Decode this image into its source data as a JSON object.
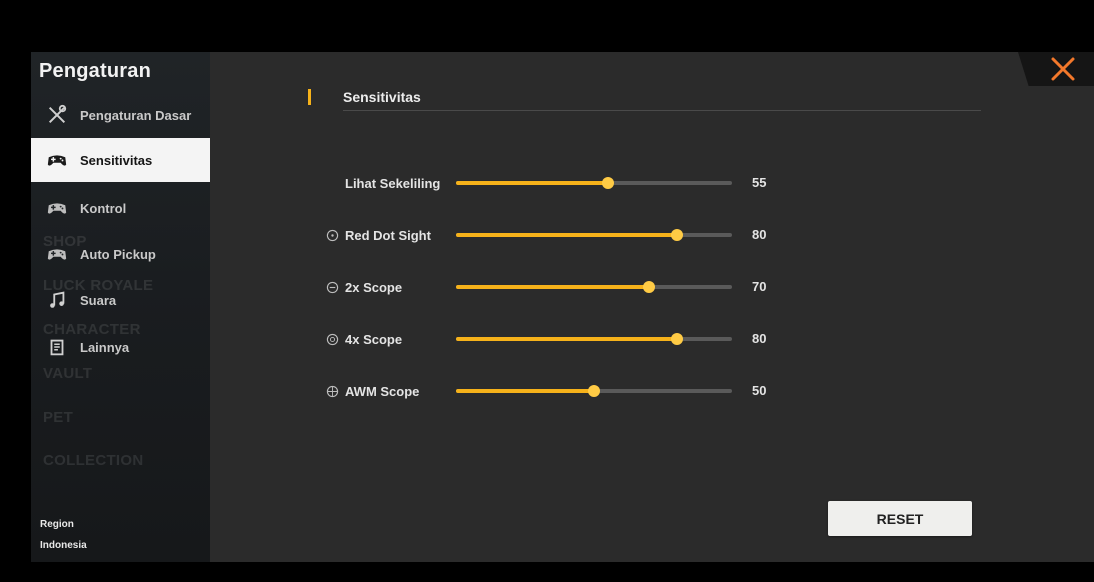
{
  "sidebar": {
    "title": "Pengaturan",
    "items": [
      {
        "label": "Pengaturan Dasar",
        "icon": "tools-icon",
        "active": false
      },
      {
        "label": "Sensitivitas",
        "icon": "gamepad-icon",
        "active": true
      },
      {
        "label": "Kontrol",
        "icon": "gamepad-icon",
        "active": false
      },
      {
        "label": "Auto Pickup",
        "icon": "gamepad-icon",
        "active": false
      },
      {
        "label": "Suara",
        "icon": "music-note-icon",
        "active": false
      },
      {
        "label": "Lainnya",
        "icon": "document-icon",
        "active": false
      }
    ],
    "region_label": "Region",
    "region_value": "Indonesia",
    "background_menu": [
      "SHOP",
      "LUCK ROYALE",
      "CHARACTER",
      "VAULT",
      "PET",
      "COLLECTION"
    ]
  },
  "section": {
    "title": "Sensitivitas"
  },
  "sliders": [
    {
      "label": "Lihat Sekeliling",
      "value": "55",
      "level": 0.55,
      "icon": null
    },
    {
      "label": "Red Dot Sight",
      "value": "80",
      "level": 0.8,
      "icon": "red-dot-icon"
    },
    {
      "label": "2x Scope",
      "value": "70",
      "level": 0.7,
      "icon": "scope-2x-icon"
    },
    {
      "label": "4x Scope",
      "value": "80",
      "level": 0.8,
      "icon": "scope-4x-icon"
    },
    {
      "label": "AWM Scope",
      "value": "50",
      "level": 0.5,
      "icon": "awm-scope-icon"
    }
  ],
  "reset_label": "RESET",
  "colors": {
    "accent": "#f6b21a",
    "thumb": "#ffcb45",
    "close": "#f3782b"
  },
  "close_icon": "close-icon"
}
